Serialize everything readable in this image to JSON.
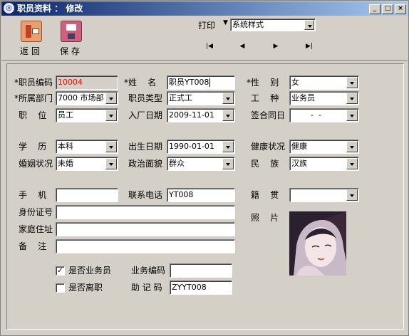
{
  "window": {
    "title": "职员资料 ： 修改"
  },
  "toolbar": {
    "back_label": "返回",
    "save_label": "保存",
    "print_label": "打印",
    "print_style_value": "系统样式"
  },
  "form": {
    "emp_code_label": "*职员编码",
    "emp_code_value": "10004",
    "name_label": "*姓    名",
    "name_value": "职员YT008",
    "gender_label": "*性    别",
    "gender_value": "女",
    "dept_label": "*所属部门",
    "dept_value": "7000 市场部",
    "emp_type_label": "职员类型",
    "emp_type_value": "正式工",
    "job_type_label": "工    种",
    "job_type_value": "业务员",
    "position_label": "职    位",
    "position_value": "员工",
    "hire_date_label": "入厂日期",
    "hire_date_value": "2009-11-01",
    "contract_label": "签合同日",
    "contract_value": "  -  -",
    "edu_label": "学    历",
    "edu_value": "本科",
    "birth_label": "出生日期",
    "birth_value": "1990-01-01",
    "health_label": "健康状况",
    "health_value": "健康",
    "marital_label": "婚姻状况",
    "marital_value": "未婚",
    "political_label": "政治面貌",
    "political_value": "群众",
    "ethnic_label": "民    族",
    "ethnic_value": "汉族",
    "mobile_label": "手    机",
    "mobile_value": "",
    "phone_label": "联系电话",
    "phone_value": "YT008",
    "native_label": "籍    贯",
    "native_value": "",
    "id_label": "身份证号",
    "id_value": "",
    "address_label": "家庭住址",
    "address_value": "",
    "remark_label": "备    注",
    "remark_value": "",
    "photo_label": "照    片",
    "is_sales_label": "是否业务员",
    "is_sales_checked": "✓",
    "sales_code_label": "业务编码",
    "sales_code_value": "",
    "is_left_label": "是否离职",
    "is_left_checked": "",
    "mnemonic_label": "助 记 码",
    "mnemonic_value": "ZYYT008"
  }
}
